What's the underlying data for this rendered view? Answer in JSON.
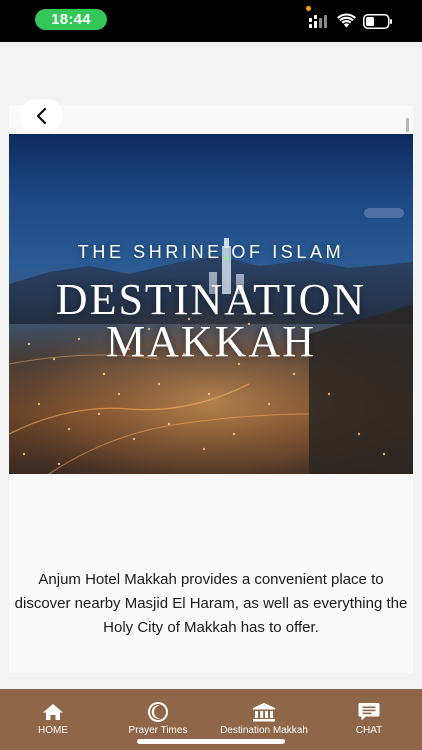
{
  "status_bar": {
    "time": "18:44",
    "icons": [
      "signal-icon",
      "wifi-icon",
      "battery-icon"
    ]
  },
  "navigation": {
    "back_icon": "chevron-left-icon"
  },
  "hero": {
    "subtitle": "THE SHRINE OF ISLAM",
    "title_line1": "DESTINATION",
    "title_line2": "MAKKAH"
  },
  "description": "Anjum Hotel Makkah provides a convenient place to discover nearby Masjid El Haram, as well as everything the Holy City of Makkah has to offer.",
  "tab_bar": {
    "items": [
      {
        "label": "HOME",
        "icon": "home-icon"
      },
      {
        "label": "Prayer Times",
        "icon": "crescent-icon"
      },
      {
        "label": "Destination Makkah",
        "icon": "building-icon"
      },
      {
        "label": "CHAT",
        "icon": "chat-icon"
      }
    ]
  },
  "colors": {
    "tab_bar": "#8f6648",
    "time_pill": "#33c759",
    "background": "#f3f3f3"
  }
}
